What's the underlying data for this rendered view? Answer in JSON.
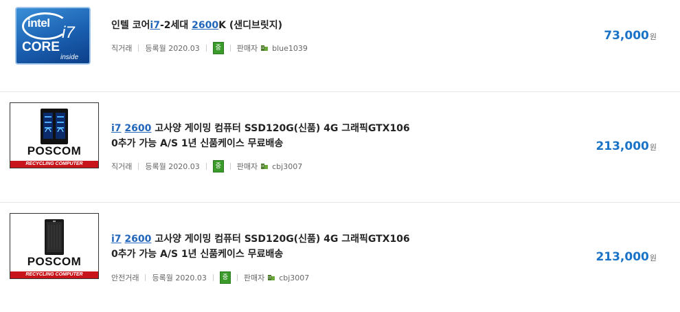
{
  "items": [
    {
      "title_parts": [
        "인텔 코어",
        "i7",
        "-2세대 ",
        "2600",
        "K (샌디브릿지)"
      ],
      "trade": "직거래",
      "date": "등록월 2020.03",
      "grade": "중",
      "seller_label": "판매자",
      "seller": "blue1039",
      "price": "73,000",
      "won": "원",
      "thumb_icon": "intel-core-i7-logo"
    },
    {
      "title_link1": "i7",
      "title_link2": "2600",
      "title_rest": " 고사양 게이밍 컴퓨터 SSD120G(신품) 4G 그래픽GTX106",
      "title_line2": "0추가 가능 A/S 1년 신품케이스 무료배송",
      "trade": "직거래",
      "date": "등록월 2020.03",
      "grade": "중",
      "seller_label": "판매자",
      "seller": "cbj3007",
      "price": "213,000",
      "won": "원",
      "brand": "POSCOM",
      "brand_sub": "RECYCLING COMPUTER"
    },
    {
      "title_link1": "i7",
      "title_link2": "2600",
      "title_rest": " 고사양 게이밍 컴퓨터 SSD120G(신품) 4G 그래픽GTX106",
      "title_line2": "0추가 가능 A/S 1년 신품케이스 무료배송",
      "trade": "안전거래",
      "date": "등록월 2020.03",
      "grade": "중",
      "seller_label": "판매자",
      "seller": "cbj3007",
      "price": "213,000",
      "won": "원",
      "brand": "POSCOM",
      "brand_sub": "RECYCLING COMPUTER"
    }
  ],
  "colors": {
    "accent": "#1a73c7",
    "grade_badge": "#3a9a2a",
    "poscom_red": "#c8151b"
  }
}
